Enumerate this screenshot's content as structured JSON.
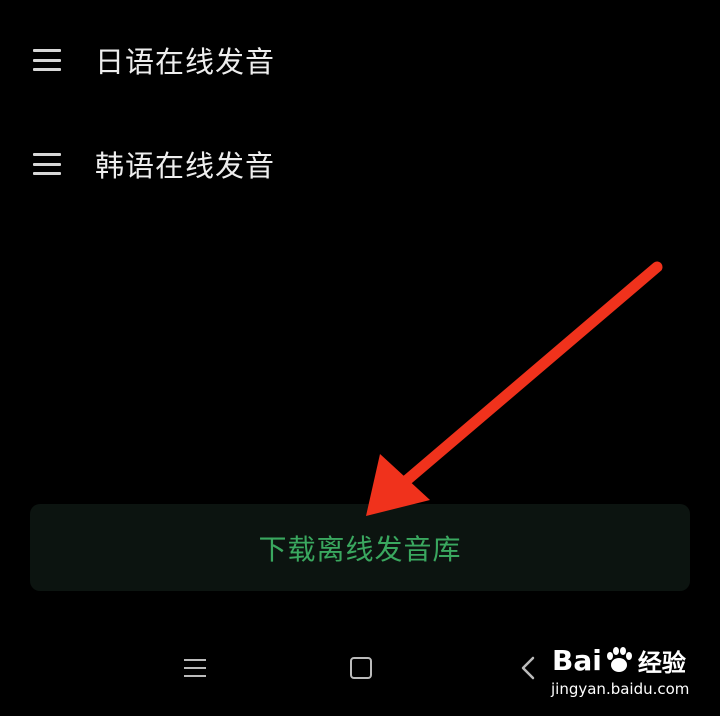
{
  "list": {
    "items": [
      {
        "label": "日语在线发音"
      },
      {
        "label": "韩语在线发音"
      }
    ]
  },
  "download_button": {
    "label": "下载离线发音库"
  },
  "colors": {
    "accent": "#3aa85f",
    "annotation": "#f0321c",
    "background": "#000000"
  },
  "icons": {
    "drag_handle": "drag-handle-icon",
    "nav_menu": "menu-icon",
    "nav_home": "home-icon",
    "nav_back": "back-icon"
  },
  "watermark": {
    "logo_prefix": "Bai",
    "logo_suffix": "经验",
    "url": "jingyan.baidu.com"
  }
}
